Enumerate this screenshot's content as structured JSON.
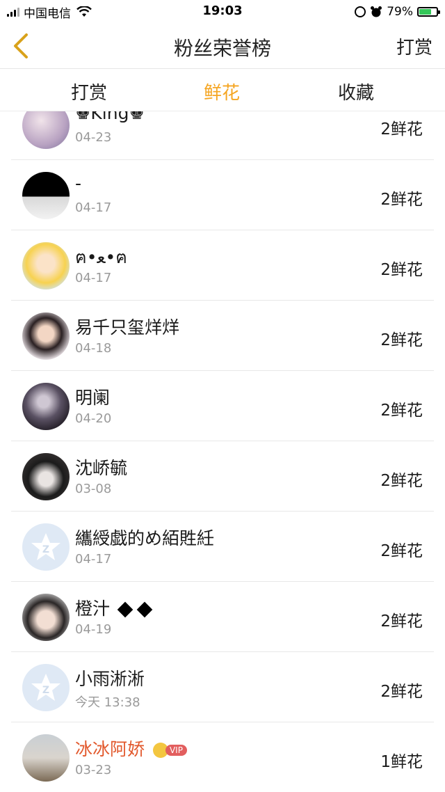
{
  "status_bar": {
    "carrier": "中国电信",
    "time": "19:03",
    "battery_percent": "79%",
    "battery_level": 0.79
  },
  "nav": {
    "title": "粉丝荣誉榜",
    "right_action": "打赏",
    "back_icon": "chevron-left-icon",
    "accent_color": "#f5a623"
  },
  "tabs": [
    {
      "label": "打赏",
      "active": false
    },
    {
      "label": "鲜花",
      "active": true
    },
    {
      "label": "收藏",
      "active": false
    }
  ],
  "fans": [
    {
      "name": "♚King♚",
      "date": "04-23",
      "amount": "2鲜花"
    },
    {
      "name": "-",
      "date": "04-17",
      "amount": "2鲜花"
    },
    {
      "name": "ฅ•ﻌ•ฅ",
      "date": "04-17",
      "amount": "2鲜花"
    },
    {
      "name": "易千只玺烊烊",
      "date": "04-18",
      "amount": "2鲜花"
    },
    {
      "name": "明阑",
      "date": "04-20",
      "amount": "2鲜花"
    },
    {
      "name": "沈峤毓",
      "date": "03-08",
      "amount": "2鲜花"
    },
    {
      "name": "纗綬戯的め絔貹紝",
      "date": "04-17",
      "amount": "2鲜花"
    },
    {
      "name": "橙汁",
      "date": "04-19",
      "amount": "2鲜花"
    },
    {
      "name": "小雨淅淅",
      "date": "今天 13:38",
      "amount": "2鲜花"
    },
    {
      "name": "冰冰阿娇",
      "date": "03-23",
      "amount": "1鲜花",
      "vip_label": "VIP"
    }
  ]
}
